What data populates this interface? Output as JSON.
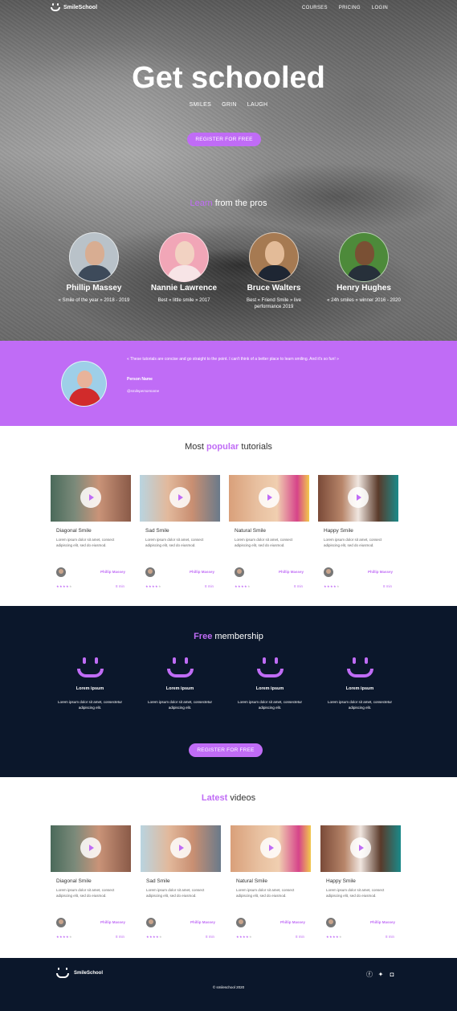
{
  "nav": {
    "logo_text": "SmileSchool",
    "links": [
      "COURSES",
      "PRICING",
      "LOGIN"
    ]
  },
  "hero": {
    "title": "Get schooled",
    "tags": [
      "SMILES",
      "GRIN",
      "LAUGH"
    ],
    "cta": "REGISTER FOR FREE"
  },
  "learn": {
    "accent": "Learn",
    "rest": " from the pros"
  },
  "pros": [
    {
      "name": "Phillip Massey",
      "award": "« Smile of the year » 2018 - 2019"
    },
    {
      "name": "Nannie Lawrence",
      "award": "Best « little smile » 2017"
    },
    {
      "name": "Bruce Walters",
      "award": "Best « Friend Smile » live performance 2019"
    },
    {
      "name": "Henry Hughes",
      "award": "« 24h smiles » winner 2016 - 2020"
    }
  ],
  "testimonial": {
    "quote": "« These tutorials are concise and go straight to the point. I can't think of a better place to learn smiling. And it's so fun! »",
    "person": "Person Name",
    "handle": "@smilepersonname"
  },
  "popular": {
    "plain_before": "Most ",
    "accent": "popular",
    "plain_after": " tutorials",
    "cards": [
      {
        "title": "Diagonal Smile",
        "desc": "Lorem ipsum dolor sit amet, consect adipiscing elit, sed do eiusmod.",
        "author": "Phillip Massey",
        "duration": "8 min"
      },
      {
        "title": "Sad Smile",
        "desc": "Lorem ipsum dolor sit amet, consect adipiscing elit, sed do eiusmod.",
        "author": "Phillip Massey",
        "duration": "8 min"
      },
      {
        "title": "Natural Smile",
        "desc": "Lorem ipsum dolor sit amet, consect adipiscing elit, sed do eiusmod.",
        "author": "Phillip Massey",
        "duration": "8 min"
      },
      {
        "title": "Happy Smile",
        "desc": "Lorem ipsum dolor sit amet, consect adipiscing elit, sed do eiusmod.",
        "author": "Phillip Massey",
        "duration": "8 min"
      }
    ]
  },
  "membership": {
    "accent": "Free",
    "rest": " membership",
    "features": [
      {
        "title": "Lorem ipsum",
        "desc": "Lorem ipsum dolor sit amet, consectetur adipiscing elit."
      },
      {
        "title": "Lorem ipsum",
        "desc": "Lorem ipsum dolor sit amet, consectetur adipiscing elit."
      },
      {
        "title": "Lorem ipsum",
        "desc": "Lorem ipsum dolor sit amet, consectetur adipiscing elit."
      },
      {
        "title": "Lorem ipsum",
        "desc": "Lorem ipsum dolor sit amet, consectetur adipiscing elit."
      }
    ],
    "cta": "REGISTER FOR FREE"
  },
  "latest": {
    "accent": "Latest",
    "rest": " videos",
    "cards": [
      {
        "title": "Diagonal Smile",
        "desc": "Lorem ipsum dolor sit amet, consect adipiscing elit, sed do eiusmod.",
        "author": "Phillip Massey",
        "duration": "8 min"
      },
      {
        "title": "Sad Smile",
        "desc": "Lorem ipsum dolor sit amet, consect adipiscing elit, sed do eiusmod.",
        "author": "Phillip Massey",
        "duration": "8 min"
      },
      {
        "title": "Natural Smile",
        "desc": "Lorem ipsum dolor sit amet, consect adipiscing elit, sed do eiusmod.",
        "author": "Phillip Massey",
        "duration": "8 min"
      },
      {
        "title": "Happy Smile",
        "desc": "Lorem ipsum dolor sit amet, consect adipiscing elit, sed do eiusmod.",
        "author": "Phillip Massey",
        "duration": "8 min"
      }
    ]
  },
  "footer": {
    "logo_text": "SmileSchool",
    "social_icons": [
      "facebook-icon",
      "twitter-icon",
      "instagram-icon"
    ],
    "copyright": "© smileschool 2020"
  },
  "colors": {
    "accent": "#c06cf6",
    "dark": "#0b172b"
  }
}
